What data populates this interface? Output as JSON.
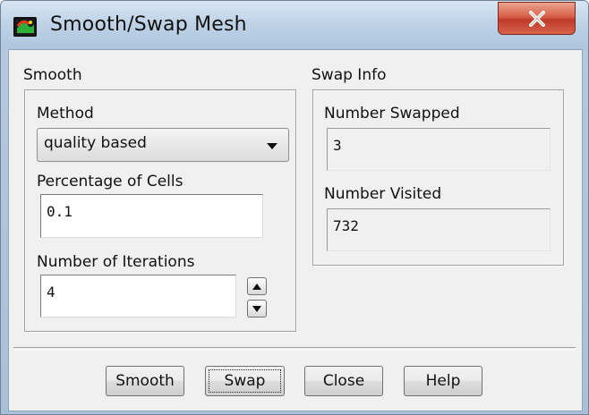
{
  "window": {
    "title": "Smooth/Swap Mesh",
    "title_icon": "fluent-app-icon",
    "close_icon": "close-x-icon"
  },
  "smooth": {
    "group_label": "Smooth",
    "method_label": "Method",
    "method_value": "quality based",
    "percentage_label": "Percentage of Cells",
    "percentage_value": "0.1",
    "iterations_label": "Number of Iterations",
    "iterations_value": "4"
  },
  "swap_info": {
    "group_label": "Swap Info",
    "swapped_label": "Number Swapped",
    "swapped_value": "3",
    "visited_label": "Number Visited",
    "visited_value": "732"
  },
  "buttons": {
    "smooth": "Smooth",
    "swap": "Swap",
    "close": "Close",
    "help": "Help"
  },
  "colors": {
    "title_bar": "#bfd3e7",
    "close_button": "#c0392b",
    "dialog_bg": "#f0f0f0"
  }
}
